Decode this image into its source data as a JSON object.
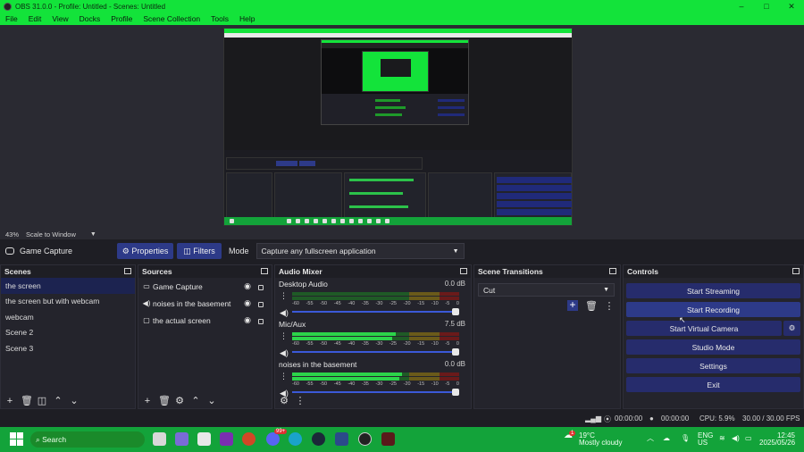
{
  "window": {
    "title": "OBS 31.0.0 - Profile: Untitled - Scenes: Untitled",
    "min": "–",
    "max": "□",
    "close": "✕"
  },
  "menu": [
    "File",
    "Edit",
    "View",
    "Docks",
    "Profile",
    "Scene Collection",
    "Tools",
    "Help"
  ],
  "preview": {
    "zoom": "43%",
    "scale_mode": "Scale to Window"
  },
  "source_toolbar": {
    "source_name": "Game Capture",
    "properties_label": "Properties",
    "filters_label": "Filters",
    "mode_label": "Mode",
    "mode_value": "Capture any fullscreen application"
  },
  "scenes": {
    "title": "Scenes",
    "items": [
      "the screen",
      "the screen but with webcam",
      "webcam",
      "Scene 2",
      "Scene 3"
    ]
  },
  "sources": {
    "title": "Sources",
    "items": [
      "Game Capture",
      "noises in the basement",
      "the actual screen"
    ]
  },
  "mixer": {
    "title": "Audio Mixer",
    "ticks": [
      "-60",
      "-55",
      "-50",
      "-45",
      "-40",
      "-35",
      "-30",
      "-25",
      "-20",
      "-15",
      "-10",
      "-5",
      "0"
    ],
    "channels": [
      {
        "name": "Desktop Audio",
        "db": "0.0 dB",
        "level": 0.0
      },
      {
        "name": "Mic/Aux",
        "db": "7.5 dB",
        "level": 0.62
      },
      {
        "name": "noises in the basement",
        "db": "0.0 dB",
        "level": 0.66
      }
    ]
  },
  "transitions": {
    "title": "Scene Transitions",
    "value": "Cut"
  },
  "controls": {
    "title": "Controls",
    "start_streaming": "Start Streaming",
    "start_recording": "Start Recording",
    "start_virtual_camera": "Start Virtual Camera",
    "studio_mode": "Studio Mode",
    "settings": "Settings",
    "exit": "Exit"
  },
  "status": {
    "stream_time": "00:00:00",
    "rec_time": "00:00:00",
    "cpu": "CPU: 5.9%",
    "fps": "30.00 / 30.00 FPS"
  },
  "taskbar": {
    "search": "Search",
    "weather_temp": "19°C",
    "weather_desc": "Mostly cloudy",
    "weather_badge": "1",
    "lang": "ENG",
    "region": "US",
    "time": "12:45",
    "date": "2025/05/26",
    "notif_badge": "99+"
  },
  "colors": {
    "accent_green": "#13e33a",
    "taskbar_green": "#13a33a",
    "button_blue": "#2d3a88",
    "control_blue": "#262c6c"
  }
}
